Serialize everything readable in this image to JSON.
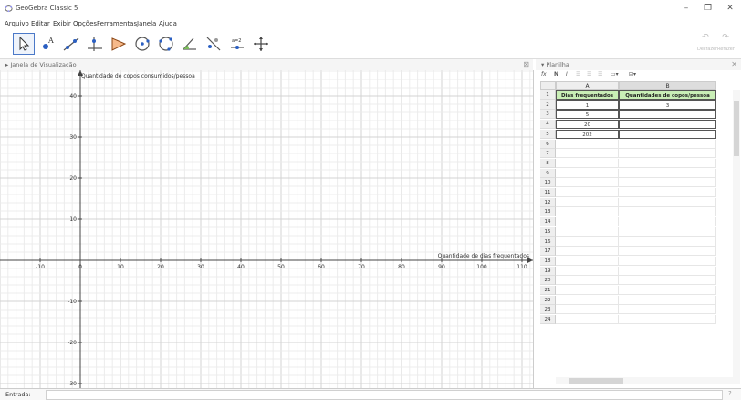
{
  "window": {
    "title": "GeoGebra Classic 5",
    "minimize": "–",
    "maximize": "❐",
    "close": "✕"
  },
  "menu": [
    "Arquivo",
    "Editar",
    "Exibir",
    "Opções",
    "Ferramentas",
    "Janela",
    "Ajuda"
  ],
  "tools": [
    "move-tool",
    "point-tool",
    "line-tool",
    "perpendicular-line-tool",
    "polygon-tool",
    "circle-tool",
    "circle-three-points-tool",
    "angle-tool",
    "reflect-tool",
    "slider-tool",
    "move-graphics-view-tool"
  ],
  "slider_tool_text": "a=2",
  "undo": {
    "undo_label": "Desfazer",
    "redo_label": "Refazer"
  },
  "graphics": {
    "panel_title": "Janela de Visualização",
    "y_axis_label": "Quantidade de copos consumidos/pessoa",
    "x_axis_label": "Quantidade de dias frequentados",
    "x_ticks": [
      "-10",
      "0",
      "10",
      "20",
      "30",
      "40",
      "50",
      "60",
      "70",
      "80",
      "90",
      "100",
      "110"
    ],
    "y_ticks": [
      "40",
      "30",
      "20",
      "10",
      "-10",
      "-20",
      "-30"
    ]
  },
  "spreadsheet": {
    "panel_title": "Planilha",
    "toolbar": [
      "fx",
      "N",
      "I"
    ],
    "columns": [
      "A",
      "B"
    ],
    "rows": [
      "1",
      "2",
      "3",
      "4",
      "5",
      "6",
      "7",
      "8",
      "9",
      "10",
      "11",
      "12",
      "13",
      "14",
      "15",
      "16",
      "17",
      "18",
      "19",
      "20",
      "21",
      "22",
      "23",
      "24"
    ],
    "header": [
      "Dias frequentados",
      "Quantidades de copos/pessoa"
    ],
    "data": [
      [
        "1",
        "3"
      ],
      [
        "5",
        ""
      ],
      [
        "20",
        ""
      ],
      [
        "202",
        ""
      ]
    ]
  },
  "input": {
    "label": "Entrada:",
    "help": "?"
  }
}
